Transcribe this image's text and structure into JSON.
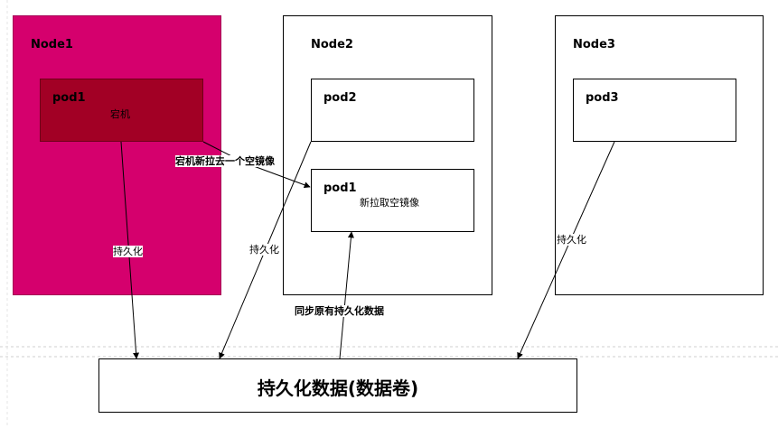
{
  "colors": {
    "node1_fill": "#d5006d",
    "pod1_fill": "#a20025",
    "line": "#000000"
  },
  "node1": {
    "title": "Node1"
  },
  "node2": {
    "title": "Node2"
  },
  "node3": {
    "title": "Node3"
  },
  "pod1_old": {
    "title": "pod1",
    "subtitle": "宕机"
  },
  "pod2": {
    "title": "pod2"
  },
  "pod1_new": {
    "title": "pod1",
    "subtitle": "新拉取空镜像"
  },
  "pod3": {
    "title": "pod3"
  },
  "storage": {
    "title": "持久化数据(数据卷)"
  },
  "edges": {
    "repull": "宕机新拉去一个空镜像",
    "persist1": "持久化",
    "persist2": "持久化",
    "persist3": "持久化",
    "sync": "同步原有持久化数据"
  }
}
